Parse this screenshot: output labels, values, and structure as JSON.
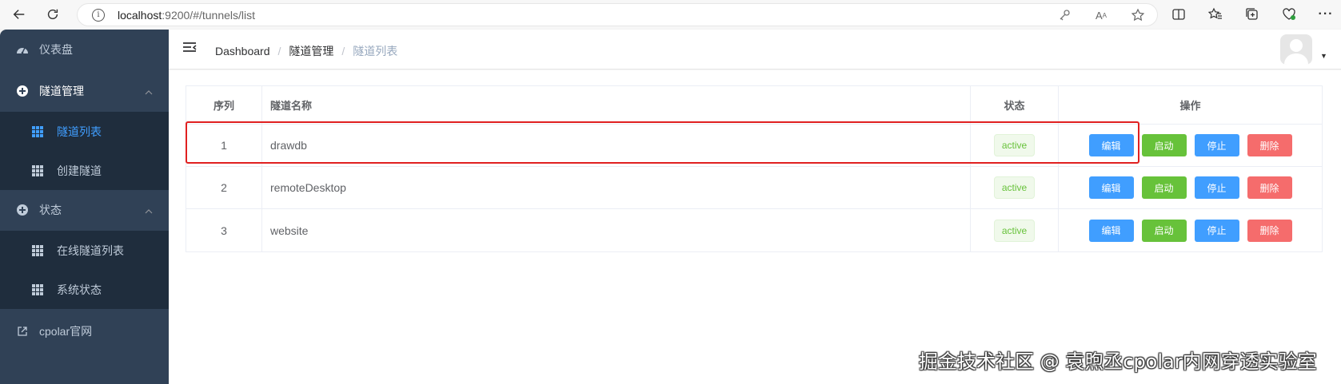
{
  "browser": {
    "url_host": "localhost",
    "url_rest": ":9200/#/tunnels/list"
  },
  "sidebar": {
    "items": [
      {
        "label": "仪表盘",
        "icon": "dashboard-icon"
      },
      {
        "label": "隧道管理",
        "icon": "plus-circle-icon",
        "expanded": true,
        "children": [
          {
            "label": "隧道列表",
            "icon": "grid-icon",
            "active": true
          },
          {
            "label": "创建隧道",
            "icon": "grid-icon"
          }
        ]
      },
      {
        "label": "状态",
        "icon": "plus-circle-icon",
        "expanded": true,
        "children": [
          {
            "label": "在线隧道列表",
            "icon": "grid-icon"
          },
          {
            "label": "系统状态",
            "icon": "grid-icon"
          }
        ]
      },
      {
        "label": "cpolar官网",
        "icon": "external-link-icon"
      }
    ]
  },
  "breadcrumb": {
    "items": [
      "Dashboard",
      "隧道管理",
      "隧道列表"
    ],
    "separator": "/"
  },
  "table": {
    "headers": [
      "序列",
      "隧道名称",
      "状态",
      "操作"
    ],
    "rows": [
      {
        "index": "1",
        "name": "drawdb",
        "status": "active"
      },
      {
        "index": "2",
        "name": "remoteDesktop",
        "status": "active"
      },
      {
        "index": "3",
        "name": "website",
        "status": "active"
      }
    ],
    "actions": {
      "edit": "编辑",
      "start": "启动",
      "stop": "停止",
      "delete": "删除"
    }
  },
  "watermark": "掘金技术社区 @ 袁煦丞cpolar内网穿透实验室",
  "colors": {
    "sidebar_bg": "#304156",
    "submenu_bg": "#1f2d3d",
    "active": "#409eff",
    "success": "#67c23a",
    "danger": "#f56c6c",
    "highlight": "#e02020"
  }
}
